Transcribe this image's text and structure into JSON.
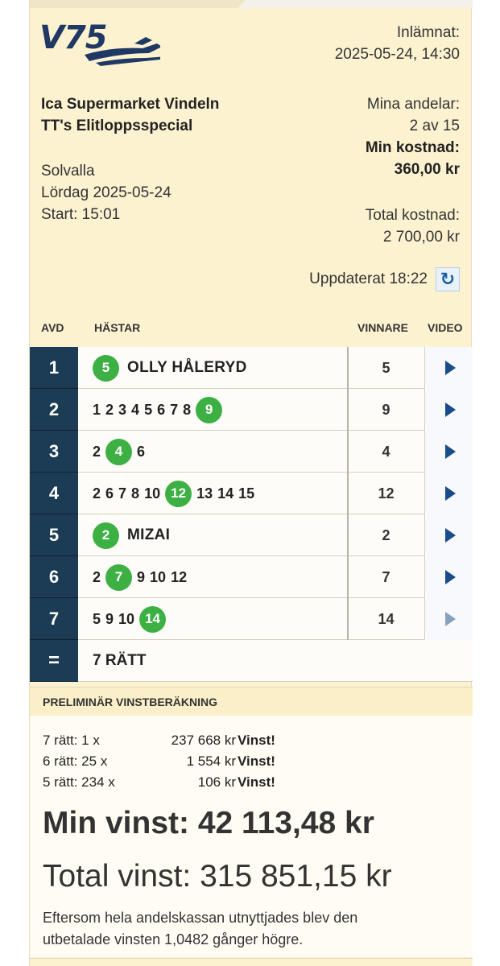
{
  "header": {
    "logo_text": "V75",
    "submitted_label": "Inlämnat:",
    "submitted_value": "2025-05-24, 14:30",
    "store": "Ica Supermarket Vindeln",
    "system_name": "TT's Elitloppsspecial",
    "track": "Solvalla",
    "date": "Lördag 2025-05-24",
    "start": "Start: 15:01",
    "shares_label": "Mina andelar:",
    "shares_value": "2 av 15",
    "my_cost_label": "Min kostnad:",
    "my_cost_value": "360,00 kr",
    "total_cost_label": "Total kostnad:",
    "total_cost_value": "2 700,00 kr",
    "updated": "Uppdaterat 18:22"
  },
  "table": {
    "col_avd": "AVD",
    "col_horses": "HÄSTAR",
    "col_winner": "VINNARE",
    "col_video": "VIDEO",
    "rows": [
      {
        "avd": "1",
        "winner": "5"
      },
      {
        "avd": "2",
        "winner": "9"
      },
      {
        "avd": "3",
        "winner": "4"
      },
      {
        "avd": "4",
        "winner": "12"
      },
      {
        "avd": "5",
        "winner": "2"
      },
      {
        "avd": "6",
        "winner": "7"
      },
      {
        "avd": "7",
        "winner": "14"
      }
    ],
    "r1": {
      "badge": "5",
      "name": "OLLY HÅLERYD"
    },
    "r2": {
      "n1": "1",
      "n2": "2",
      "n3": "3",
      "n4": "4",
      "n5": "5",
      "n6": "6",
      "n7": "7",
      "n8": "8",
      "badge": "9"
    },
    "r3": {
      "n1": "2",
      "badge": "4",
      "n2": "6"
    },
    "r4": {
      "n1": "2",
      "n2": "6",
      "n3": "7",
      "n4": "8",
      "n5": "10",
      "badge": "12",
      "n6": "13",
      "n7": "14",
      "n8": "15"
    },
    "r5": {
      "badge": "2",
      "name": "MIZAI"
    },
    "r6": {
      "n1": "2",
      "badge": "7",
      "n2": "9",
      "n3": "10",
      "n4": "12"
    },
    "r7": {
      "n1": "5",
      "n2": "9",
      "n3": "10",
      "badge": "14"
    },
    "sum_symbol": "=",
    "sum_text": "7 RÄTT"
  },
  "prelim": {
    "title": "PRELIMINÄR VINSTBERÄKNING",
    "lines": [
      {
        "label": "7 rätt: 1 x",
        "amount": "237 668 kr",
        "status": "Vinst!"
      },
      {
        "label": "6 rätt: 25 x",
        "amount": "1 554 kr",
        "status": "Vinst!"
      },
      {
        "label": "5 rätt: 234 x",
        "amount": "106 kr",
        "status": "Vinst!"
      }
    ],
    "my_win": "Min vinst: 42 113,48 kr",
    "total_win": "Total vinst: 315 851,15 kr",
    "note": "Eftersom hela andelskassan utnyttjades blev den utbetalade vinsten 1,0482 gånger högre."
  },
  "colors": {
    "card_bg": "#fdf2d0",
    "avd_bg": "#1c3c56",
    "badge_green": "#3cb043",
    "play_blue": "#1b4c8a",
    "logo_navy": "#1f3864"
  },
  "icons": {
    "refresh": "refresh-icon",
    "play": "play-icon",
    "logo": "v75-horse-logo"
  }
}
